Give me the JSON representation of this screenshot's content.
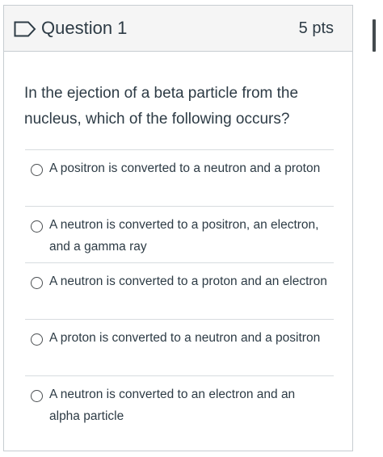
{
  "question": {
    "title": "Question 1",
    "points": "5 pts",
    "text": "In the ejection of a beta particle from the nucleus, which of the following occurs?",
    "flag_icon": "flag-icon"
  },
  "answers": [
    {
      "label": "A positron is converted to a neutron and a proton"
    },
    {
      "label": "A neutron is converted to a positron, an electron, and a gamma ray"
    },
    {
      "label": "A neutron is converted to a proton and an electron"
    },
    {
      "label": "A proton is converted to a neutron and a positron"
    },
    {
      "label": "A neutron is converted to an electron and an alpha particle"
    }
  ],
  "colors": {
    "header_bg": "#f5f5f5",
    "border": "#c7cdd1",
    "text": "#2d3b45"
  }
}
